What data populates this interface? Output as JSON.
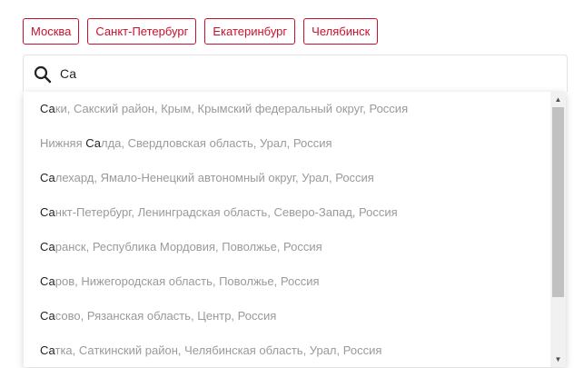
{
  "chips": [
    "Москва",
    "Санкт-Петербург",
    "Екатеринбург",
    "Челябинск"
  ],
  "search": {
    "value": "Са",
    "icon": "search-icon"
  },
  "suggestions": [
    {
      "before": "",
      "match": "Са",
      "after": "ки, Сакский район, Крым, Крымский федеральный округ, Россия"
    },
    {
      "before": "Нижняя ",
      "match": "Са",
      "after": "лда, Свердловская область, Урал, Россия"
    },
    {
      "before": "",
      "match": "Са",
      "after": "лехард, Ямало-Ненецкий автономный округ, Урал, Россия"
    },
    {
      "before": "",
      "match": "Са",
      "after": "нкт-Петербург, Ленинградская область, Северо-Запад, Россия"
    },
    {
      "before": "",
      "match": "Са",
      "after": "ранск, Республика Мордовия, Поволжье, Россия"
    },
    {
      "before": "",
      "match": "Са",
      "after": "ров, Нижегородская область, Поволжье, Россия"
    },
    {
      "before": "",
      "match": "Са",
      "after": "сово, Рязанская область, Центр, Россия"
    },
    {
      "before": "",
      "match": "Са",
      "after": "тка, Саткинский район, Челябинская область, Урал, Россия"
    }
  ],
  "colors": {
    "accent": "#c8102e",
    "suggestion_text": "#9a9a9a",
    "match_text": "#222222"
  }
}
